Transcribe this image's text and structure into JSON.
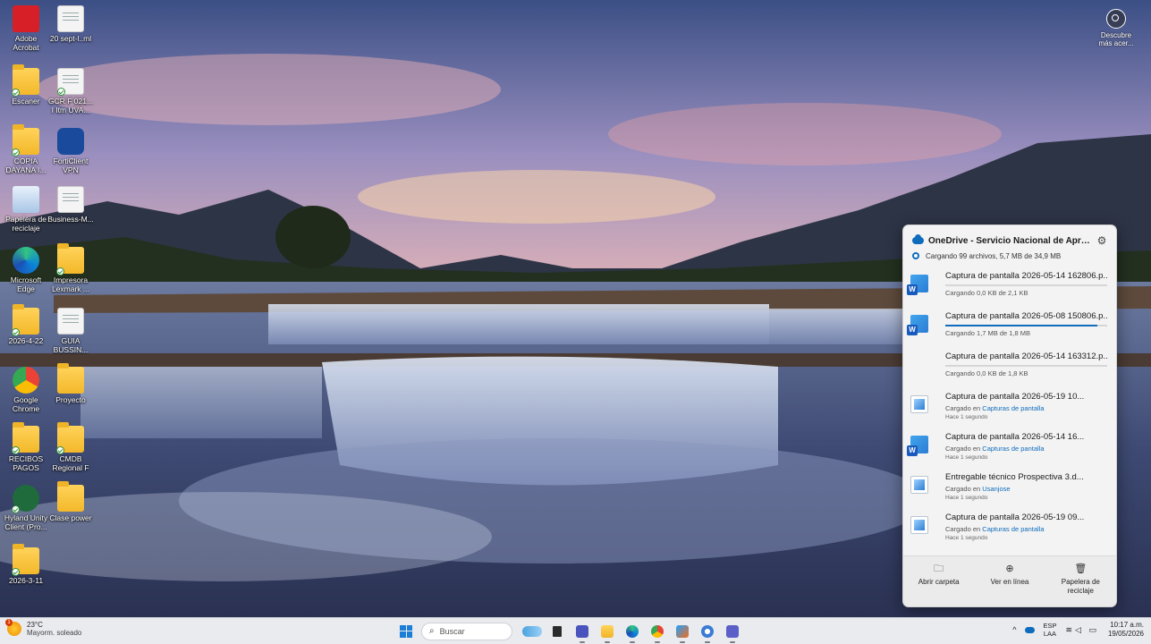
{
  "desktop": {
    "icons": [
      {
        "label": "Adobe Acrobat",
        "icon": "adobe-acrobat-icon"
      },
      {
        "label": "20 sept-l..ml",
        "icon": "document-icon"
      },
      {
        "label": "Escaner",
        "icon": "folder-icon"
      },
      {
        "label": "GCR F 021... I Itm UVA...",
        "icon": "document-icon"
      },
      {
        "label": "COPIA DAYANA I...",
        "icon": "folder-icon"
      },
      {
        "label": "FortiClient VPN",
        "icon": "forticlient-icon"
      },
      {
        "label": "Papelera de reciclaje",
        "icon": "recycle-bin-icon"
      },
      {
        "label": "Business-M...",
        "icon": "document-icon"
      },
      {
        "label": "Microsoft Edge",
        "icon": "edge-icon"
      },
      {
        "label": "Impresora Lexmark ...",
        "icon": "folder-icon"
      },
      {
        "label": "2026-4-22",
        "icon": "folder-icon"
      },
      {
        "label": "GUIA BUSSIN...",
        "icon": "pdf-icon"
      },
      {
        "label": "Google Chrome",
        "icon": "chrome-icon"
      },
      {
        "label": "Proyecto",
        "icon": "folder-icon"
      },
      {
        "label": "RECIBOS PAGOS",
        "icon": "folder-icon"
      },
      {
        "label": "CMDB Regional F",
        "icon": "folder-icon"
      },
      {
        "label": "Hyland Unity Client (Pro...",
        "icon": "onbase-icon"
      },
      {
        "label": "Clase power",
        "icon": "folder-icon"
      },
      {
        "label": "2026-3-11",
        "icon": "folder-icon"
      }
    ],
    "spotlight": {
      "label": "Descubre más acer..."
    }
  },
  "onedrive": {
    "title": "OneDrive - Servicio Nacional de Aprendi...",
    "status": "Cargando 99 archivos, 5,7 MB de 34,9 MB",
    "files": [
      {
        "name": "Captura de pantalla 2026-05-14 162806.p...",
        "sub": "Cargando 0,0 KB de 2,1 KB",
        "progress": 0.0,
        "icon": "word-icon",
        "uploading": true
      },
      {
        "name": "Captura de pantalla 2026-05-08 150806.p...",
        "sub": "Cargando 1,7 MB de 1,8 MB",
        "progress": 0.94,
        "icon": "word-icon",
        "uploading": true
      },
      {
        "name": "Captura de pantalla 2026-05-14 163312.p...",
        "sub": "Cargando 0,0 KB de 1,8 KB",
        "progress": 0.0,
        "icon": "blank",
        "uploading": true
      },
      {
        "name": "Captura de pantalla 2026-05-19 10...",
        "sub_prefix": "Cargado en",
        "location": "Capturas de pantalla",
        "time": "Hace 1 segundo",
        "icon": "image-icon"
      },
      {
        "name": "Captura de pantalla 2026-05-14 16...",
        "sub_prefix": "Cargado en",
        "location": "Capturas de pantalla",
        "time": "Hace 1 segundo",
        "icon": "word-icon"
      },
      {
        "name": "Entregable técnico Prospectiva 3.d...",
        "sub_prefix": "Cargado en",
        "location": "Usanjose",
        "time": "Hace 1 segundo",
        "icon": "image-icon"
      },
      {
        "name": "Captura de pantalla 2026-05-19 09...",
        "sub_prefix": "Cargado en",
        "location": "Capturas de pantalla",
        "time": "Hace 1 segundo",
        "icon": "image-icon"
      }
    ],
    "footer": {
      "open_folder": "Abrir carpeta",
      "view_online": "Ver en línea",
      "recycle_bin": "Papelera de reciclaje"
    }
  },
  "taskbar": {
    "weather": {
      "temp": "23°C",
      "condition": "Mayorm. soleado",
      "badge": "1"
    },
    "search_placeholder": "Buscar",
    "language": {
      "top": "ESP",
      "bottom": "LAA"
    },
    "time": "10:17 a.m.",
    "date": "19/05/2026",
    "apps": [
      "bing-icon",
      "file-explorer-icon",
      "outlook-icon",
      "folder-icon",
      "edge-icon",
      "chrome-icon",
      "teams-pwa-icon",
      "settings-icon",
      "teams-icon"
    ]
  },
  "colors": {
    "accent": "#0f6cbd",
    "taskbar": "#e9ebef",
    "flyout": "#f3f3f3"
  }
}
